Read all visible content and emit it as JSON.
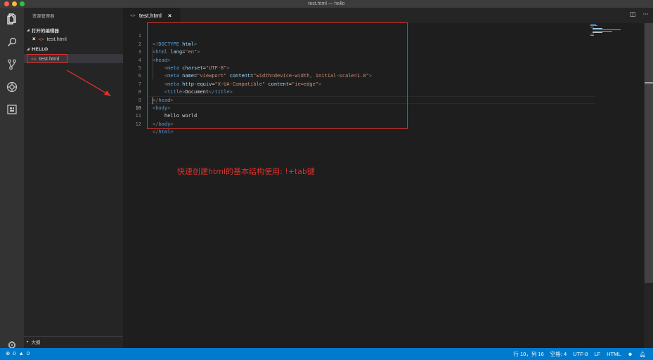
{
  "window": {
    "title": "test.html — hello"
  },
  "sidebar": {
    "header": "资源管理器",
    "open_editors_label": "打开的编辑器",
    "open_editors_files": [
      {
        "name": "test.html"
      }
    ],
    "folder_label": "HELLO",
    "folder_files": [
      {
        "name": "test.html"
      }
    ],
    "outline_label": "大纲"
  },
  "tab": {
    "label": "test.html",
    "close": "×"
  },
  "editor": {
    "line_numbers": [
      "1",
      "2",
      "3",
      "4",
      "5",
      "6",
      "7",
      "8",
      "9",
      "10",
      "11",
      "12"
    ],
    "current_line": 10
  },
  "annotation": "快速创建html的基本结构使用: !+tab键",
  "statusbar": {
    "errors": "0",
    "warnings": "0",
    "position": "行 10，列 16",
    "spaces": "空格: 4",
    "encoding": "UTF-8",
    "eol": "LF",
    "language": "HTML"
  },
  "colors": {
    "accent": "#007acc",
    "annotation_red": "#e0302a",
    "editor_bg": "#1e1e1e",
    "sidebar_bg": "#252526"
  }
}
